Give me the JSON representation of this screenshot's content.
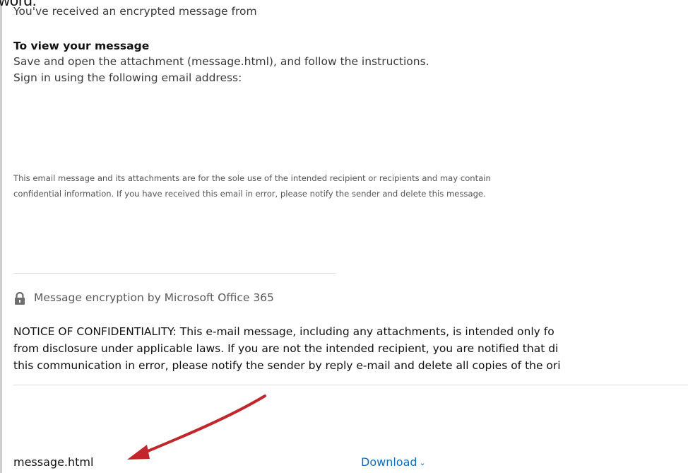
{
  "overlay": {
    "cropped_heading": "word."
  },
  "email": {
    "intro": "You've received an encrypted message from",
    "view_title": "To view your message",
    "instruction_1": "Save and open the attachment (message.html), and follow the instructions.",
    "instruction_2": "Sign in using the following email address:",
    "disclaimer_1": "This email message and its attachments are for the sole use of the intended recipient or recipients and may contain",
    "disclaimer_2": "confidential information. If you have received this email in error, please notify the sender and delete this message.",
    "encryption_label": "Message encryption by Microsoft Office 365",
    "notice_1": "NOTICE OF CONFIDENTIALITY: This e-mail message, including any attachments, is intended only fo",
    "notice_2": "from disclosure under applicable laws. If you are not the intended recipient, you are notified that di",
    "notice_3": "this communication in error, please notify the sender by reply e-mail and delete all copies of the ori"
  },
  "attachment": {
    "name": "message.html",
    "download_label": "Download",
    "download_icon": "chevron-down-icon"
  },
  "colors": {
    "link": "#0f6cbd",
    "annotation_arrow": "#c0262b"
  },
  "icons": {
    "lock": "lock-icon"
  }
}
